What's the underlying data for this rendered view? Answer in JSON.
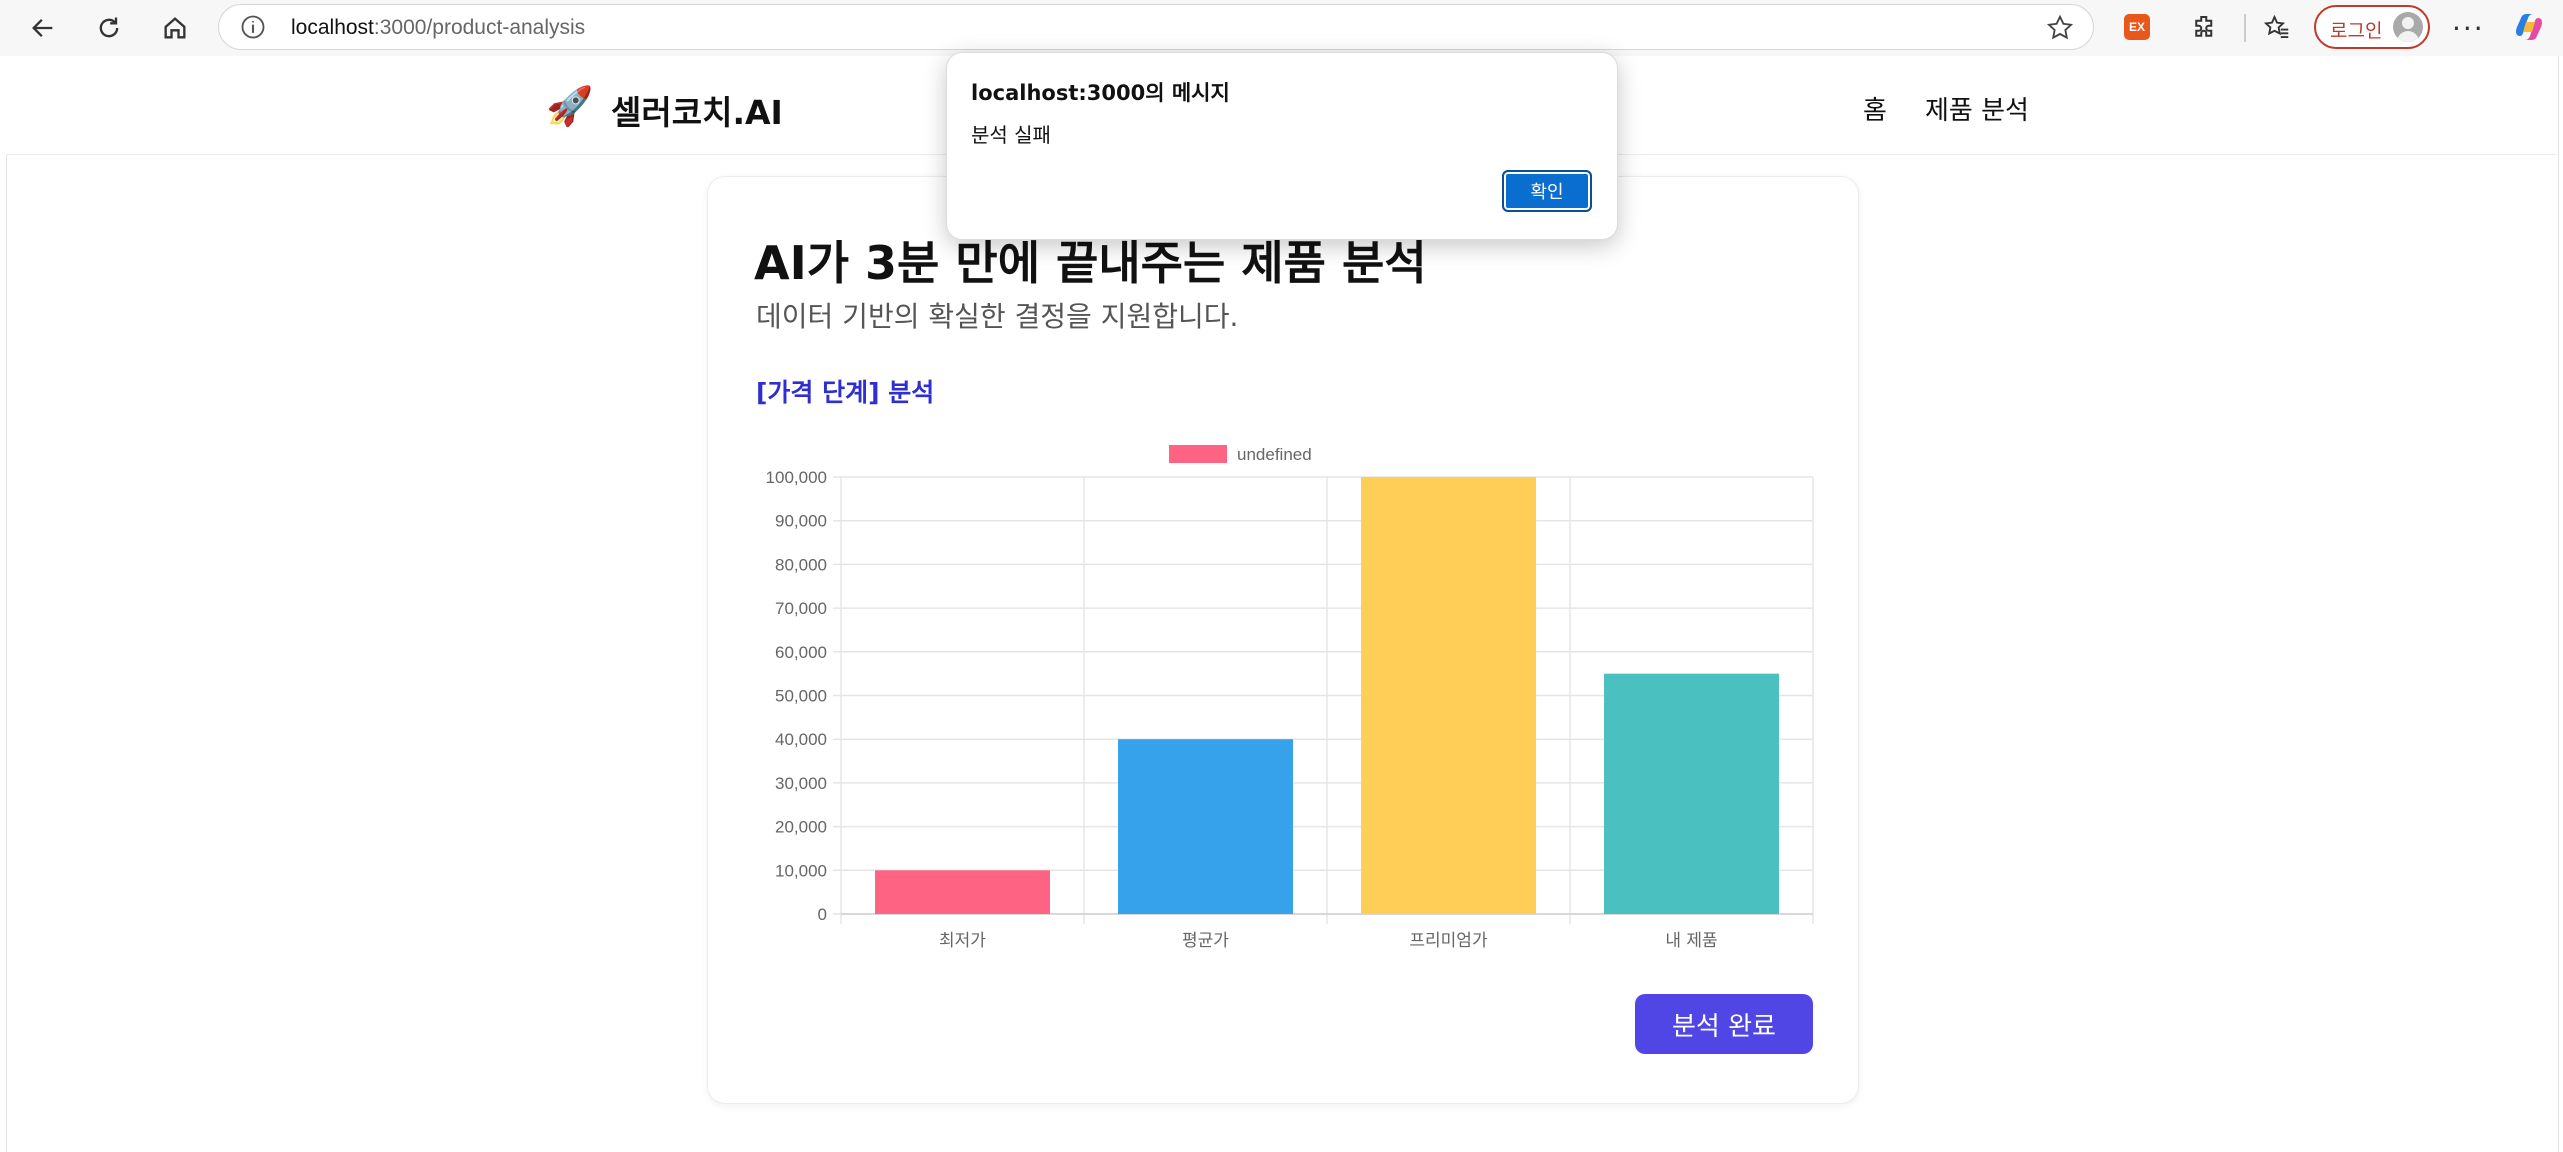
{
  "browser": {
    "url_host": "localhost",
    "url_path": ":3000/product-analysis",
    "extension_badge": "EX",
    "profile_label": "로그인",
    "more_label": "···"
  },
  "nav": {
    "brand_icon": "🚀",
    "brand_name": "셀러코치.AI",
    "links": [
      "홈",
      "제품 분석"
    ]
  },
  "card": {
    "title": "AI가 3분 만에 끝내주는 제품 분석",
    "subtitle": "데이터 기반의 확실한 결정을 지원합니다.",
    "section_label": "[가격 단계] 분석",
    "done_button": "분석 완료"
  },
  "dialog": {
    "title": "localhost:3000의 메시지",
    "message": "분석 실패",
    "ok_button": "확인"
  },
  "chart_data": {
    "type": "bar",
    "categories": [
      "최저가",
      "평균가",
      "프리미엄가",
      "내 제품"
    ],
    "series": [
      {
        "name": "undefined",
        "values": [
          10000,
          40000,
          100000,
          55000
        ]
      }
    ],
    "colors": [
      "#ff6384",
      "#36a2eb",
      "#ffce56",
      "#4bc0c0"
    ],
    "ylim": [
      0,
      100000
    ],
    "yticks": [
      "0",
      "10,000",
      "20,000",
      "30,000",
      "40,000",
      "50,000",
      "60,000",
      "70,000",
      "80,000",
      "90,000",
      "100,000"
    ],
    "grid": true,
    "legend": "top-center"
  }
}
